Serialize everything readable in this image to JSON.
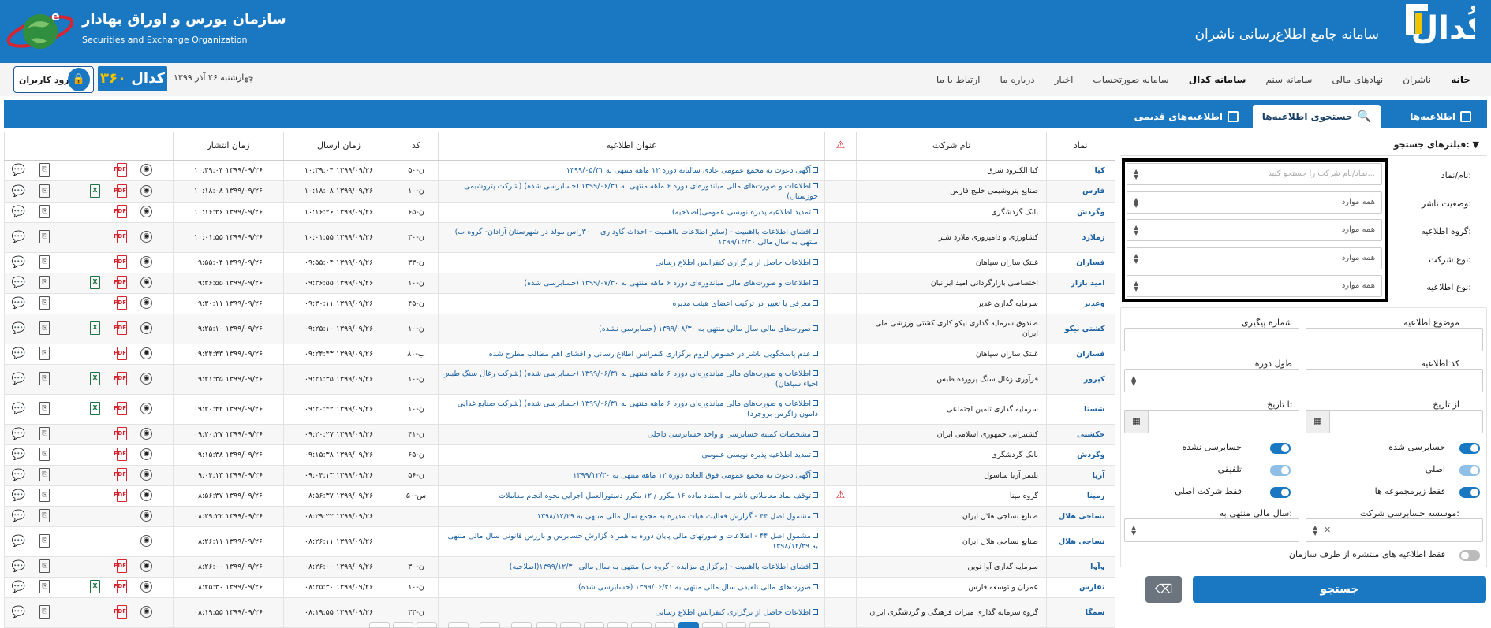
{
  "header": {
    "codal_logo_text": "کُدال",
    "system_title": "سامانه جامع اطلاع‌رسانی ناشران",
    "org_name_fa": "سازمان بورس و اوراق بهادار",
    "org_name_en": "Securities and Exchange Organization",
    "colors": {
      "primary": "#1a78c2",
      "accent": "#f2c300"
    }
  },
  "nav": {
    "items": [
      {
        "label": "خانه",
        "active": false
      },
      {
        "label": "ناشران",
        "active": false
      },
      {
        "label": "نهادهای مالی",
        "active": false
      },
      {
        "label": "سامانه سنم",
        "active": false
      },
      {
        "label": "سامانه کدال",
        "active": true
      },
      {
        "label": "سامانه صورتحساب",
        "active": false
      },
      {
        "label": "اخبار",
        "active": false
      },
      {
        "label": "درباره ما",
        "active": false
      },
      {
        "label": "ارتباط با ما",
        "active": false
      }
    ],
    "date": "چهارشنبه ۲۶ آذر ۱۳۹۹",
    "codal360_a": "کدال",
    "codal360_b": "۳۶۰",
    "login_label": "ورود کاربران"
  },
  "tabs": [
    {
      "label": "اطلاعیه‌ها",
      "icon": "layout-icon"
    },
    {
      "label": "جستجوی اطلاعیه‌ها",
      "icon": "search-icon"
    },
    {
      "label": "اطلاعیه‌های قدیمی",
      "icon": "layers-icon"
    }
  ],
  "filters": {
    "header": "فیلترهای جستجو:",
    "symbol_label": "نام/نماد:",
    "symbol_placeholder": "نماد/نام شرکت را جستجو کنید...",
    "publisher_status_label": "وضعیت ناشر:",
    "notice_group_label": "گروه اطلاعیه:",
    "company_type_label": "نوع شرکت:",
    "notice_type_label": "نوع اطلاعیه:",
    "all_option": "همه موارد",
    "subject_label": "موضوع اطلاعیه",
    "tracking_label": "شماره پیگیری",
    "code_label": "کد اطلاعیه",
    "period_label": "طول دوره",
    "from_date_label": "از تاریخ",
    "to_date_label": "تا تاریخ",
    "audited_label": "حسابرسی شده",
    "not_audited_label": "حسابرسی نشده",
    "original_label": "اصلی",
    "consolidated_label": "تلفیقی",
    "subsidiaries_label": "فقط زیرمجموعه ها",
    "parent_only_label": "فقط شرکت اصلی",
    "audit_firm_label": "موسسه حسابرسی شرکت:",
    "fiscal_year_label": "سال مالی منتهی به:",
    "org_only_label": "فقط اطلاعیه های منتشره از طرف سازمان",
    "toggles": {
      "audited": true,
      "not_audited": true,
      "original": false,
      "consolidated": false,
      "subsidiaries": true,
      "parent_only": true,
      "org_only": false
    },
    "search_button": "جستجو"
  },
  "table": {
    "headers": {
      "symbol": "نماد",
      "company": "نام شرکت",
      "title": "عنوان اطلاعیه",
      "code": "کد",
      "sent": "زمان ارسال",
      "published": "زمان انتشار"
    },
    "rows": [
      {
        "symbol": "کیا",
        "company": "کیا الکترود شرق",
        "title": "آگهی دعوت به مجمع عمومی عادی سالیانه دوره ۱۲ ماهه منتهی به ۱۳۹۹/۰۵/۳۱",
        "code": "ن-۵۰",
        "sent": "۱۳۹۹/۰۹/۲۶ ۱۰:۳۹:۰۴",
        "published": "۱۳۹۹/۰۹/۲۶ ۱۰:۳۹:۰۴",
        "warn": false,
        "pdf": true,
        "xls": false,
        "att": true
      },
      {
        "symbol": "فارس",
        "company": "صنایع پتروشیمی خلیج فارس",
        "title": "اطلاعات و صورت‌های مالی میاندوره‌ای دوره ۶ ماهه منتهی به ۱۳۹۹/۰۶/۳۱ (حسابرسی شده) (شرکت پتروشیمی خوزستان)",
        "code": "ن-۱۰",
        "sent": "۱۳۹۹/۰۹/۲۶ ۱۰:۱۸:۰۸",
        "published": "۱۳۹۹/۰۹/۲۶ ۱۰:۱۸:۰۸",
        "warn": false,
        "pdf": true,
        "xls": true,
        "att": true
      },
      {
        "symbol": "وگردش",
        "company": "بانک گردشگری",
        "title": "تمدید اطلاعیه پذیره نویسی عمومی(اصلاحیه)",
        "code": "ن-۶۵",
        "sent": "۱۳۹۹/۰۹/۲۶ ۱۰:۱۶:۲۶",
        "published": "۱۳۹۹/۰۹/۲۶ ۱۰:۱۶:۲۶",
        "warn": false,
        "pdf": true,
        "xls": false,
        "att": true
      },
      {
        "symbol": "زملارد",
        "company": "کشاورزی و دامپروری ملارد شیر",
        "title": "افشای اطلاعات بااهمیت - (سایر اطلاعات بااهمیت - احداث گاوداری ۳۰۰۰راس مولد در شهرستان آزادان- گروه ب) منتهی به سال مالی ۱۳۹۹/۱۲/۳۰",
        "code": "ن-۳۰",
        "sent": "۱۳۹۹/۰۹/۲۶ ۱۰:۰۱:۵۵",
        "published": "۱۳۹۹/۰۹/۲۶ ۱۰:۰۱:۵۵",
        "warn": false,
        "pdf": true,
        "xls": false,
        "att": true
      },
      {
        "symbol": "فسازان",
        "company": "غلتک سازان سپاهان",
        "title": "اطلاعات حاصل از برگزاری کنفرانس اطلاع رسانی",
        "code": "ن-۳۳",
        "sent": "۱۳۹۹/۰۹/۲۶ ۰۹:۵۵:۰۴",
        "published": "۱۳۹۹/۰۹/۲۶ ۰۹:۵۵:۰۴",
        "warn": false,
        "pdf": true,
        "xls": false,
        "att": true
      },
      {
        "symbol": "امید بازار",
        "company": "اختصاصی بازارگردانی امید ایرانیان",
        "title": "اطلاعات و صورت‌های مالی میاندوره‌ای دوره ۶ ماهه منتهی به ۱۳۹۹/۰۷/۳۰ (حسابرسی شده)",
        "code": "ن-۱۰",
        "sent": "۱۳۹۹/۰۹/۲۶ ۰۹:۳۶:۵۵",
        "published": "۱۳۹۹/۰۹/۲۶ ۰۹:۳۶:۵۵",
        "warn": false,
        "pdf": true,
        "xls": true,
        "att": true
      },
      {
        "symbol": "وغدیر",
        "company": "سرمایه گذاری غدیر",
        "title": "معرفی یا تغییر در ترکیب اعضای هیئت مدیره",
        "code": "ن-۴۵",
        "sent": "۱۳۹۹/۰۹/۲۶ ۰۹:۳۰:۱۱",
        "published": "۱۳۹۹/۰۹/۲۶ ۰۹:۳۰:۱۱",
        "warn": false,
        "pdf": true,
        "xls": false,
        "att": true
      },
      {
        "symbol": "کشتی نیکو",
        "company": "صندوق سرمایه گذاری نیکو کاری کشتی ورزشی ملی ایران",
        "title": "صورت‌های مالی سال مالی منتهی به ۱۳۹۹/۰۸/۳۰ (حسابرسی نشده)",
        "code": "ن-۱۰",
        "sent": "۱۳۹۹/۰۹/۲۶ ۰۹:۲۵:۱۰",
        "published": "۱۳۹۹/۰۹/۲۶ ۰۹:۲۵:۱۰",
        "warn": false,
        "pdf": true,
        "xls": true,
        "att": true
      },
      {
        "symbol": "فسازان",
        "company": "غلتک سازان سپاهان",
        "title": "عدم پاسخگویی ناشر در خصوص لزوم برگزاری کنفرانس اطلاع رسانی و افشای اهم مطالب مطرح شده",
        "code": "ب-۸۰",
        "sent": "۱۳۹۹/۰۹/۲۶ ۰۹:۲۴:۴۳",
        "published": "۱۳۹۹/۰۹/۲۶ ۰۹:۲۴:۴۳",
        "warn": false,
        "pdf": true,
        "xls": false,
        "att": true
      },
      {
        "symbol": "کپرور",
        "company": "فرآوری زغال سنگ پرورده طبس",
        "title": "اطلاعات و صورت‌های مالی میاندوره‌ای دوره ۶ ماهه منتهی به ۱۳۹۹/۰۶/۳۱ (حسابرسی شده) (شرکت زغال سنگ طبس احیاء سپاهان)",
        "code": "ن-۱۰",
        "sent": "۱۳۹۹/۰۹/۲۶ ۰۹:۲۱:۳۵",
        "published": "۱۳۹۹/۰۹/۲۶ ۰۹:۲۱:۳۵",
        "warn": false,
        "pdf": true,
        "xls": true,
        "att": true
      },
      {
        "symbol": "شستا",
        "company": "سرمایه گذاری تامین اجتماعی",
        "title": "اطلاعات و صورت‌های مالی میاندوره‌ای دوره ۶ ماهه منتهی به ۱۳۹۹/۰۶/۳۱ (حسابرسی شده) (شرکت صنایع غذایی دامون زاگرس بروجرد)",
        "code": "ن-۱۰",
        "sent": "۱۳۹۹/۰۹/۲۶ ۰۹:۲۰:۴۲",
        "published": "۱۳۹۹/۰۹/۲۶ ۰۹:۲۰:۴۲",
        "warn": false,
        "pdf": true,
        "xls": true,
        "att": true
      },
      {
        "symbol": "حکشتی",
        "company": "کشتیرانی جمهوری اسلامی ایران",
        "title": "مشخصات کمیته حسابرسی و واحد حسابرسی داخلی",
        "code": "ن-۴۱",
        "sent": "۱۳۹۹/۰۹/۲۶ ۰۹:۲۰:۲۷",
        "published": "۱۳۹۹/۰۹/۲۶ ۰۹:۲۰:۲۷",
        "warn": false,
        "pdf": true,
        "xls": false,
        "att": true
      },
      {
        "symbol": "وگردش",
        "company": "بانک گردشگری",
        "title": "تمدید اطلاعیه پذیره نویسی عمومی",
        "code": "ن-۶۵",
        "sent": "۱۳۹۹/۰۹/۲۶ ۰۹:۱۵:۳۸",
        "published": "۱۳۹۹/۰۹/۲۶ ۰۹:۱۵:۳۸",
        "warn": false,
        "pdf": true,
        "xls": false,
        "att": true
      },
      {
        "symbol": "آریا",
        "company": "پلیمر آریا ساسول",
        "title": "آگهی دعوت به مجمع عمومی فوق العاده دوره ۱۲ ماهه منتهی به ۱۳۹۹/۱۲/۳۰",
        "code": "ن-۵۶",
        "sent": "۱۳۹۹/۰۹/۲۶ ۰۹:۰۴:۱۳",
        "published": "۱۳۹۹/۰۹/۲۶ ۰۹:۰۴:۱۳",
        "warn": false,
        "pdf": true,
        "xls": false,
        "att": true
      },
      {
        "symbol": "رمپنا",
        "company": "گروه مپنا",
        "title": "توقف نماد معاملاتی ناشر به استناد ماده ۱۶ مکرر / ۱۲ مکرر دستورالعمل اجرایی نحوه انجام معاملات",
        "code": "س-۵۰",
        "sent": "۱۳۹۹/۰۹/۲۶ ۰۸:۵۶:۳۷",
        "published": "۱۳۹۹/۰۹/۲۶ ۰۸:۵۶:۳۷",
        "warn": true,
        "pdf": true,
        "xls": false,
        "att": true
      },
      {
        "symbol": "نساجی هلال",
        "company": "صنایع نساجی هلال ایران",
        "title": "مشمول اصل ۴۴ - گزارش فعالیت هیات مدیره به مجمع سال مالی منتهی به ۱۳۹۸/۱۲/۲۹",
        "code": "",
        "sent": "۱۳۹۹/۰۹/۲۶ ۰۸:۲۹:۲۲",
        "published": "۱۳۹۹/۰۹/۲۶ ۰۸:۲۹:۲۲",
        "warn": false,
        "pdf": false,
        "xls": false,
        "att": true
      },
      {
        "symbol": "نساجی هلال",
        "company": "صنایع نساجی هلال ایران",
        "title": "مشمول اصل ۴۴ - اطلاعات و صورتهای مالی پایان دوره به همراه گزارش حسابرس و بازرس قانونی سال مالی منتهی به ۱۳۹۸/۱۲/۲۹",
        "code": "",
        "sent": "۱۳۹۹/۰۹/۲۶ ۰۸:۲۶:۱۱",
        "published": "۱۳۹۹/۰۹/۲۶ ۰۸:۲۶:۱۱",
        "warn": false,
        "pdf": false,
        "xls": false,
        "att": true
      },
      {
        "symbol": "وآوا",
        "company": "سرمایه گذاری آوا نوین",
        "title": "افشای اطلاعات بااهمیت - (برگزاری مزایده - گروه ب) منتهی به سال مالی ۱۳۹۹/۱۲/۳۰(اصلاحیه)",
        "code": "ن-۳۰",
        "sent": "۱۳۹۹/۰۹/۲۶ ۰۸:۲۶:۰۰",
        "published": "۱۳۹۹/۰۹/۲۶ ۰۸:۲۶:۰۰",
        "warn": false,
        "pdf": true,
        "xls": false,
        "att": true
      },
      {
        "symbol": "ثفارس",
        "company": "عمران و توسعه فارس",
        "title": "صورت‌های مالی تلفیقی سال مالی منتهی به ۱۳۹۹/۰۶/۳۱ (حسابرسی شده)",
        "code": "ن-۱۰",
        "sent": "۱۳۹۹/۰۹/۲۶ ۰۸:۲۵:۳۰",
        "published": "۱۳۹۹/۰۹/۲۶ ۰۸:۲۵:۳۰",
        "warn": false,
        "pdf": true,
        "xls": true,
        "att": true
      },
      {
        "symbol": "سمگا",
        "company": "گروه سرمایه گذاری میراث فرهنگی و گردشگری ایران",
        "title": "اطلاعات حاصل از برگزاری کنفرانس اطلاع رسانی",
        "code": "ن-۳۳",
        "sent": "۱۳۹۹/۰۹/۲۶ ۰۸:۱۹:۵۵",
        "published": "۱۳۹۹/۰۹/۲۶ ۰۸:۱۹:۵۵",
        "warn": false,
        "pdf": true,
        "xls": false,
        "att": true
      }
    ]
  }
}
